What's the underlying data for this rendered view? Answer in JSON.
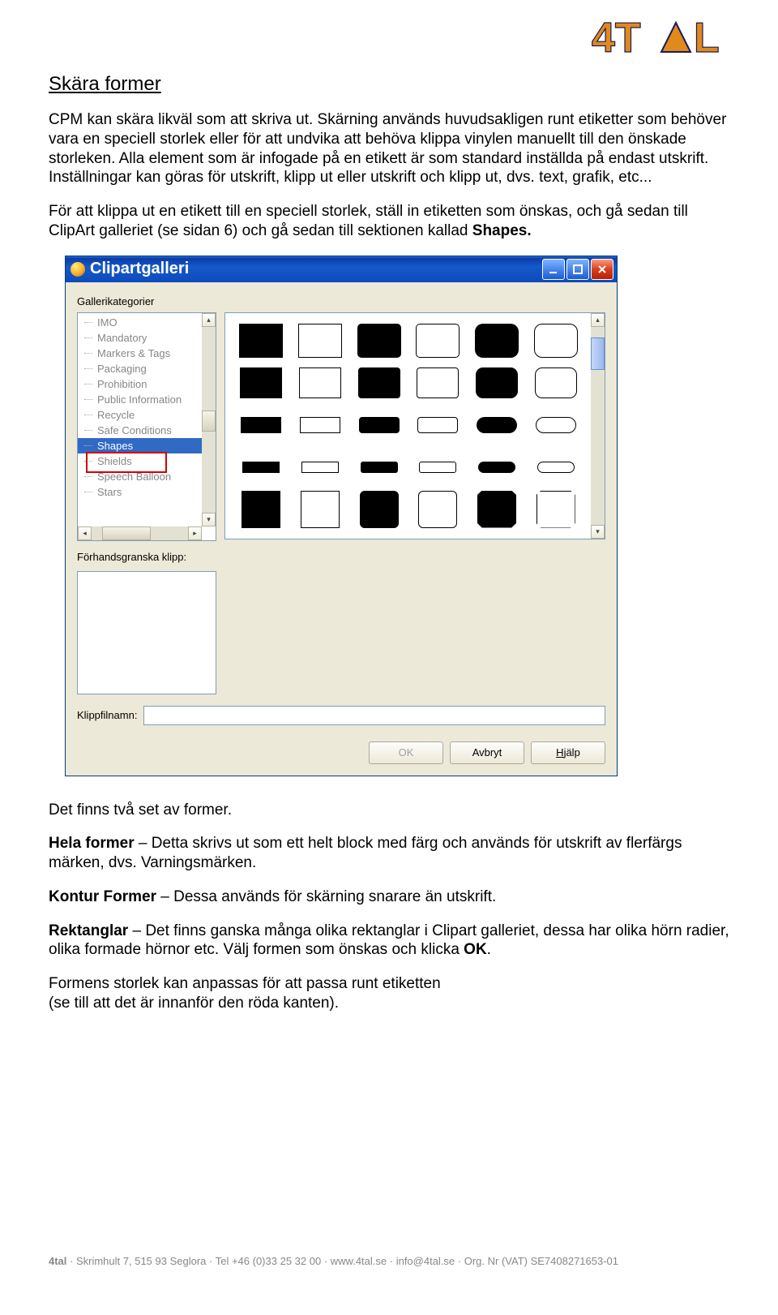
{
  "logo_text": "4T▲L",
  "heading": "Skära former",
  "para1": "CPM kan skära likväl som att skriva ut. Skärning används huvudsakligen runt etiketter som behöver vara en speciell storlek eller för att undvika att behöva klippa vinylen manuellt till den önskade storleken. Alla element som är infogade på en etikett är som standard inställda på endast utskrift. Inställningar kan göras för utskrift, klipp ut eller utskrift och klipp ut, dvs. text, grafik, etc...",
  "para2_a": "För att klippa ut en etikett till en speciell storlek, ställ in etiketten som önskas, och gå sedan till ClipArt galleriet (se sidan 6) och gå sedan till sektionen kallad ",
  "para2_b": "Shapes.",
  "dialog": {
    "title": "Clipartgalleri",
    "categories_label": "Gallerikategorier",
    "tree": [
      "IMO",
      "Mandatory",
      "Markers & Tags",
      "Packaging",
      "Prohibition",
      "Public Information",
      "Recycle",
      "Safe Conditions",
      "Shapes",
      "Shields",
      "Speech Balloon",
      "Stars"
    ],
    "selected_index": 8,
    "preview_label": "Förhandsgranska klipp:",
    "filename_label": "Klippfilnamn:",
    "buttons": {
      "ok": "OK",
      "cancel": "Avbryt",
      "help": "Hjälp"
    }
  },
  "para3": "Det finns två set av former.",
  "para4_a": "Hela former",
  "para4_b": " – Detta skrivs ut som ett helt block med färg och används för utskrift av flerfärgs märken, dvs. Varningsmärken.",
  "para5_a": "Kontur Former",
  "para5_b": " – Dessa används för skärning snarare än utskrift.",
  "para6_a": "Rektanglar",
  "para6_b": " – Det finns ganska många olika rektanglar i Clipart galleriet, dessa har olika hörn radier, olika formade hörnor etc. Välj formen som önskas och klicka ",
  "para6_c": "OK",
  "para6_d": ".",
  "para7": "Formens storlek kan anpassas för att passa runt etiketten\n(se till att det är innanför den röda kanten).",
  "footer": {
    "brand": "4tal",
    "sep": " · ",
    "addr": "Skrimhult 7, 515 93 Seglora",
    "tel": "Tel +46 (0)33 25 32 00",
    "web": "www.4tal.se",
    "mail": "info@4tal.se",
    "vat": "Org. Nr (VAT) SE7408271653-01"
  }
}
